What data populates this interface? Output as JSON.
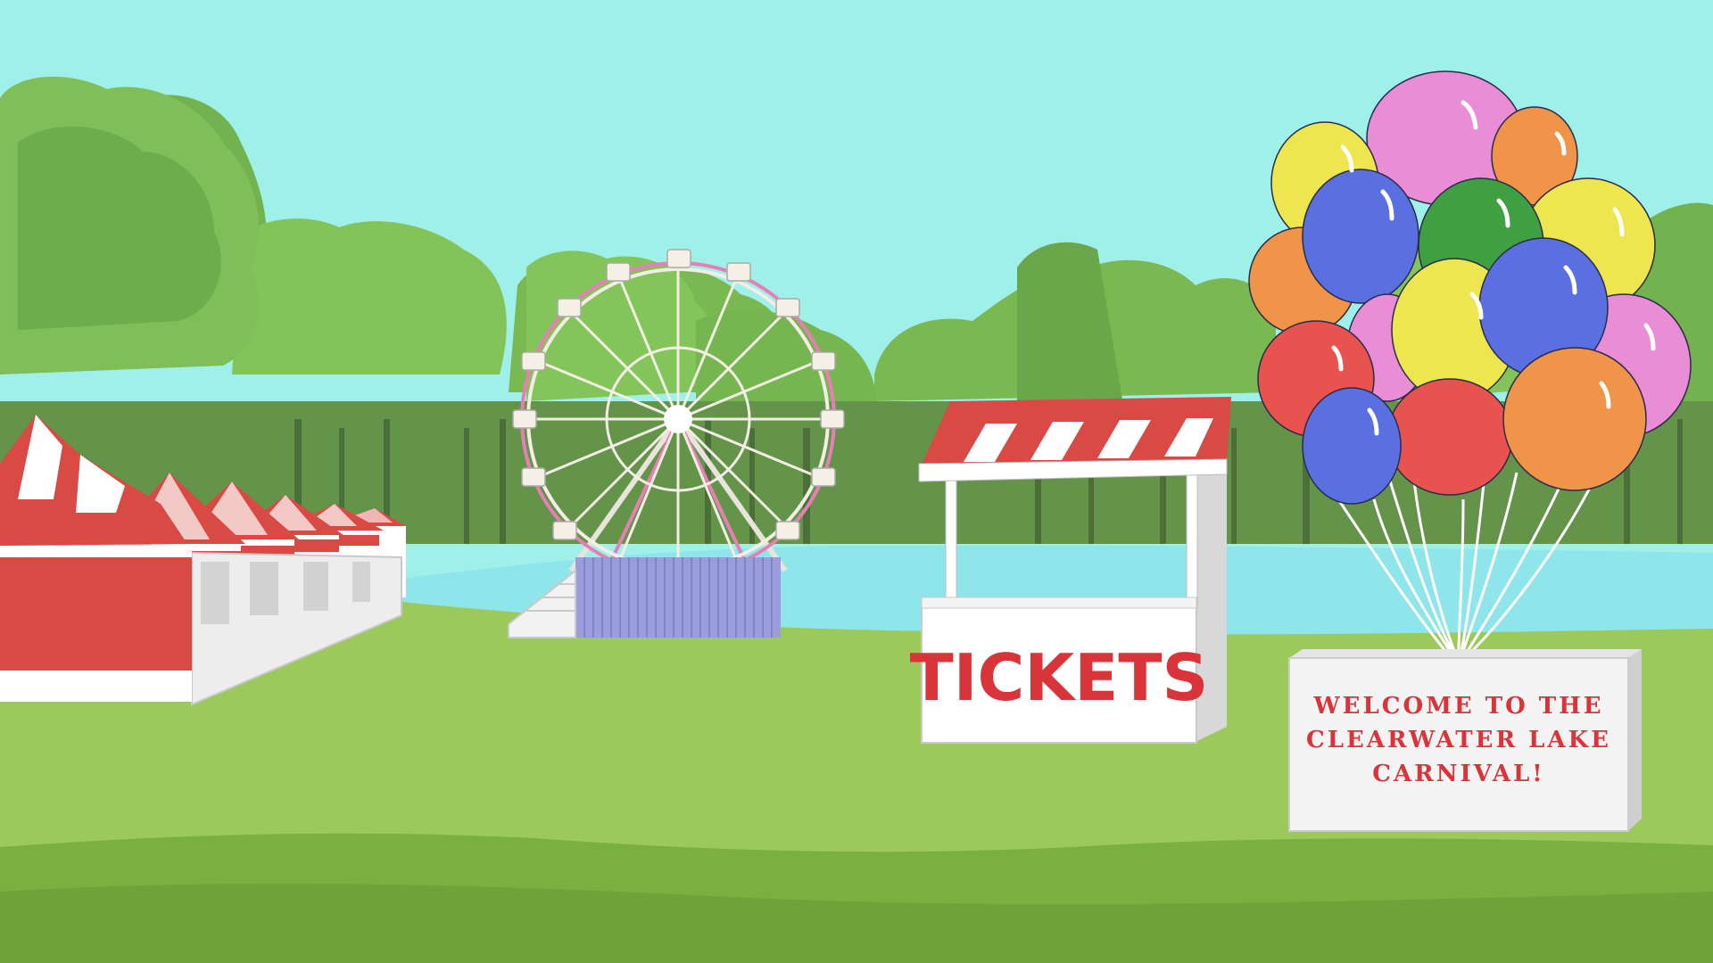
{
  "scene": {
    "ticket_booth": {
      "label": "TICKETS"
    },
    "welcome_sign": {
      "lines": [
        "WELCOME TO THE",
        "CLEARWATER LAKE",
        "CARNIVAL!"
      ]
    }
  },
  "colors": {
    "sky": "#a0f0ea",
    "tree_light": "#82c45a",
    "tree_mid": "#6aa64a",
    "tree_dark": "#5a8f3c",
    "grass": "#9cca5a",
    "grass_dark": "#6fa33a",
    "lake": "#8fe6ea",
    "tent_red": "#d84a43",
    "tent_white": "#ffffff",
    "ticket_text": "#d8343a",
    "balloon_colors": [
      "#e98ed6",
      "#f0944a",
      "#eee64e",
      "#5a6fe0",
      "#3ea040",
      "#e8524f"
    ]
  }
}
